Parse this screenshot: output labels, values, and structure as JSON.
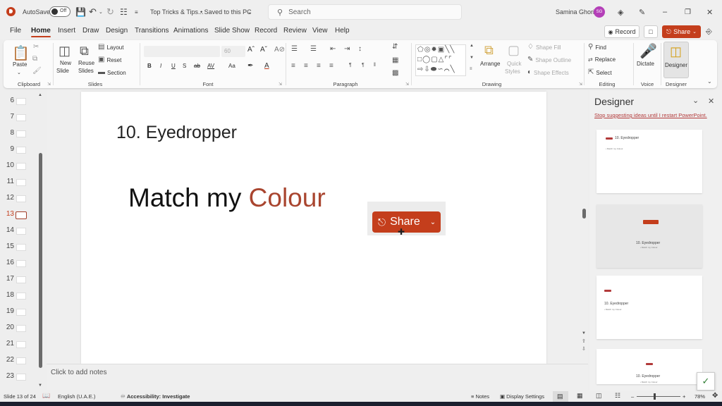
{
  "titlebar": {
    "autosave_label": "AutoSave",
    "autosave_state": "Off",
    "doc_title": "Top Tricks & Tips...",
    "save_status": "• Saved to this PC",
    "search_placeholder": "Search",
    "user_name": "Samina Ghori",
    "user_initials": "SG"
  },
  "tabs": [
    "File",
    "Home",
    "Insert",
    "Draw",
    "Design",
    "Transitions",
    "Animations",
    "Slide Show",
    "Record",
    "Review",
    "View",
    "Help"
  ],
  "active_tab": "Home",
  "top_actions": {
    "record": "Record",
    "share": "Share"
  },
  "ribbon": {
    "clipboard": {
      "label": "Clipboard",
      "paste": "Paste"
    },
    "slides": {
      "label": "Slides",
      "new_slide": "New",
      "new_slide2": "Slide",
      "reuse": "Reuse",
      "reuse2": "Slides",
      "layout": "Layout",
      "reset": "Reset",
      "section": "Section"
    },
    "font": {
      "label": "Font",
      "font_name": "",
      "font_size": "60",
      "bold": "B",
      "italic": "I",
      "underline": "U",
      "shadow": "S",
      "strike": "ab",
      "spacing": "AV",
      "case": "Aa"
    },
    "paragraph": {
      "label": "Paragraph"
    },
    "drawing": {
      "label": "Drawing",
      "arrange": "Arrange",
      "quick_styles": "Quick",
      "quick_styles2": "Styles",
      "shape_fill": "Shape Fill",
      "shape_outline": "Shape Outline",
      "shape_effects": "Shape Effects"
    },
    "editing": {
      "label": "Editing",
      "find": "Find",
      "replace": "Replace",
      "select": "Select"
    },
    "voice": {
      "label": "Voice",
      "dictate": "Dictate"
    },
    "designer": {
      "label": "Designer",
      "designer": "Designer"
    }
  },
  "thumbnails": [
    {
      "num": "6"
    },
    {
      "num": "7"
    },
    {
      "num": "8"
    },
    {
      "num": "9"
    },
    {
      "num": "10"
    },
    {
      "num": "11"
    },
    {
      "num": "12"
    },
    {
      "num": "13",
      "current": true
    },
    {
      "num": "14"
    },
    {
      "num": "15"
    },
    {
      "num": "16"
    },
    {
      "num": "17"
    },
    {
      "num": "18"
    },
    {
      "num": "19"
    },
    {
      "num": "20"
    },
    {
      "num": "21"
    },
    {
      "num": "22"
    },
    {
      "num": "23"
    }
  ],
  "slide": {
    "title": "10. Eyedropper",
    "body_plain": "Match my ",
    "body_accent": "Colour",
    "share_button_label": "Share",
    "accent_color": "#a9452f"
  },
  "notes_placeholder": "Click to add notes",
  "designer": {
    "title": "Designer",
    "stop_link": "Stop suggesting ideas until I restart PowerPoint.",
    "cards": [
      {
        "title": "10. Eyedropper",
        "subtitle": "• Match my Colour"
      },
      {
        "title": "10. Eyedropper",
        "subtitle": "• Match my Colour"
      },
      {
        "title": "10. Eyedropper",
        "subtitle": "• Match my Colour"
      },
      {
        "title": "10. Eyedropper",
        "subtitle": "• Match my Colour"
      }
    ]
  },
  "status": {
    "slide_count": "Slide 13 of 24",
    "language": "English (U.A.E.)",
    "accessibility": "Accessibility: Investigate",
    "notes": "Notes",
    "display_settings": "Display Settings",
    "zoom": "78%"
  },
  "colors": {
    "brand": "#c43e1c",
    "link": "#b23a3a"
  }
}
